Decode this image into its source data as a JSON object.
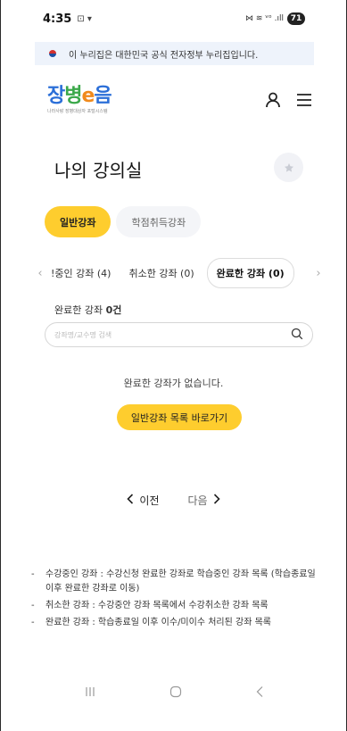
{
  "status_bar": {
    "time": "4:35",
    "left_icons": "⊡ ▾",
    "right_icons": "⋈ ≋ ᵛᵒ .ıll",
    "battery": "71"
  },
  "gov_banner": {
    "text": "이 누리집은 대한민국 공식 전자정부 누리집입니다."
  },
  "header": {
    "logo_text": [
      "장",
      "병",
      "e",
      "음"
    ],
    "logo_sub": "나라사랑 장병대상자 포털시스템"
  },
  "page": {
    "title": "나의 강의실"
  },
  "main_tabs": [
    {
      "label": "일반강좌",
      "active": true
    },
    {
      "label": "학점취득강좌",
      "active": false
    }
  ],
  "sub_tabs": [
    {
      "label": "!중인 강좌 (4)"
    },
    {
      "label": "취소한 강좌 (0)"
    },
    {
      "label": "완료한 강좌 (0)",
      "active": true
    }
  ],
  "count": {
    "label": "완료한 강좌",
    "value": "0건"
  },
  "search": {
    "placeholder": "강좌명/교수명 검색",
    "value": ""
  },
  "empty": {
    "message": "완료한 강좌가 없습니다.",
    "button": "일반강좌 목록 바로가기"
  },
  "pagination": {
    "prev": "이전",
    "next": "다음"
  },
  "notes": [
    {
      "dash": "-",
      "text": "수강중인 강좌 : 수강신청 완료한 강좌로 학습중인 강좌 목록 (학습종료일 이후 완료한 강좌로 이동)"
    },
    {
      "dash": "-",
      "text": "취소한 강좌 : 수강중안 강좌 목록에서 수강취소한 강좌 목록"
    },
    {
      "dash": "-",
      "text": "완료한 강좌 : 학습종료일 이후 이수/미이수 처리된 강좌 목록"
    }
  ],
  "colors": {
    "accent": "#fecd2e",
    "banner_bg": "#eef3fb",
    "tab_inactive_bg": "#f4f5f8"
  }
}
